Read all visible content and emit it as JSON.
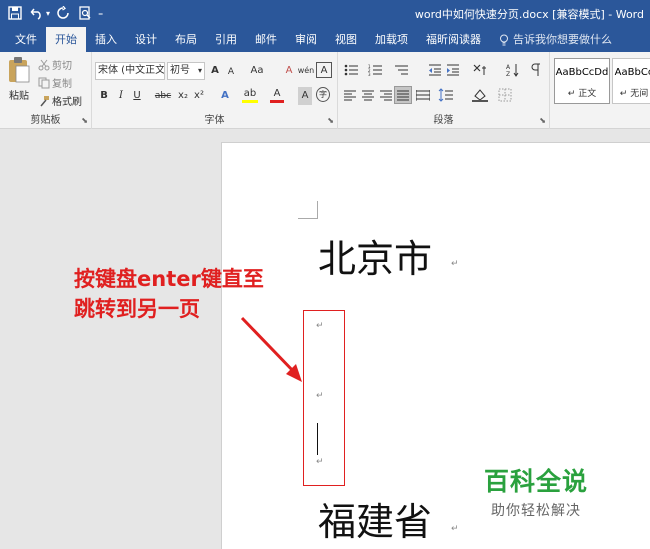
{
  "window": {
    "title": "word中如何快速分页.docx [兼容模式]  -  Word"
  },
  "quick_access": {
    "icons": [
      "save-icon",
      "undo-icon",
      "redo-icon",
      "print-preview-icon",
      "customize-icon"
    ],
    "undo_caret": "▾",
    "customize_caret": "₌"
  },
  "tabs": {
    "items": [
      "文件",
      "开始",
      "插入",
      "设计",
      "布局",
      "引用",
      "邮件",
      "审阅",
      "视图",
      "加载项",
      "福昕阅读器"
    ],
    "active": "开始",
    "tell_me": "告诉我你想要做什么"
  },
  "ribbon": {
    "clipboard": {
      "paste_label": "粘贴",
      "cut_label": "剪切",
      "copy_label": "复制",
      "format_painter_label": "格式刷",
      "group_label": "剪贴板"
    },
    "font": {
      "font_name": "宋体 (中文正文",
      "font_size": "初号",
      "grow": "A",
      "shrink": "A",
      "change_case": "Aa",
      "clear_format": "A",
      "phonetic": "wén",
      "border_char": "A",
      "bold": "B",
      "italic": "I",
      "underline": "U",
      "strikethrough": "abc",
      "subscript": "x₂",
      "superscript": "x²",
      "text_effects": "A",
      "highlight": "ab",
      "font_color": "A",
      "shading_char": "A",
      "enclose_char": "字",
      "group_label": "字体"
    },
    "paragraph": {
      "group_label": "段落"
    },
    "styles": {
      "items": [
        {
          "sample": "AaBbCcDd",
          "name": "↵ 正文"
        },
        {
          "sample": "AaBbCc",
          "name": "↵ 无间"
        }
      ]
    }
  },
  "document": {
    "heading1": "北京市",
    "heading2": "福建省",
    "paragraph_mark": "↵"
  },
  "annotation": {
    "line1": "按键盘enter键直至",
    "line2": "跳转到另一页"
  },
  "watermark": {
    "title": "百科全说",
    "subtitle": "助你轻松解决"
  },
  "colors": {
    "title_bar": "#2b579a",
    "annotation_red": "#e02020",
    "watermark_green": "#2aa13e"
  }
}
